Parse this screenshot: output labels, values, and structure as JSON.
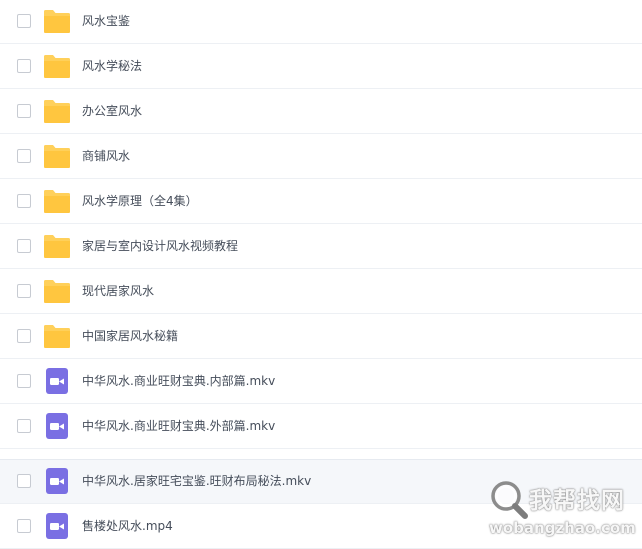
{
  "files": [
    {
      "name": "风水宝鉴",
      "type": "folder"
    },
    {
      "name": "风水学秘法",
      "type": "folder"
    },
    {
      "name": "办公室风水",
      "type": "folder"
    },
    {
      "name": "商铺风水",
      "type": "folder"
    },
    {
      "name": "风水学原理（全4集）",
      "type": "folder"
    },
    {
      "name": "家居与室内设计风水视频教程",
      "type": "folder"
    },
    {
      "name": "现代居家风水",
      "type": "folder"
    },
    {
      "name": "中国家居风水秘籍",
      "type": "folder"
    },
    {
      "name": "中华风水.商业旺财宝典.内部篇.mkv",
      "type": "video"
    },
    {
      "name": "中华风水.商业旺财宝典.外部篇.mkv",
      "type": "video"
    },
    {
      "name": "中华风水.居家旺宅宝鉴.旺财布局秘法.mkv",
      "type": "video",
      "hovered": true
    },
    {
      "name": "售楼处风水.mp4",
      "type": "video"
    }
  ],
  "icons": {
    "folder": "folder-icon",
    "video": "video-file-icon"
  },
  "colors": {
    "folder": "#FFC94D",
    "video": "#7A6FE3",
    "text": "#454D5A",
    "hover_row": "#F5F7FA",
    "divider": "#EDF0F4"
  },
  "watermark": {
    "title": "我帮找网",
    "url": "wobangzhao.com"
  }
}
